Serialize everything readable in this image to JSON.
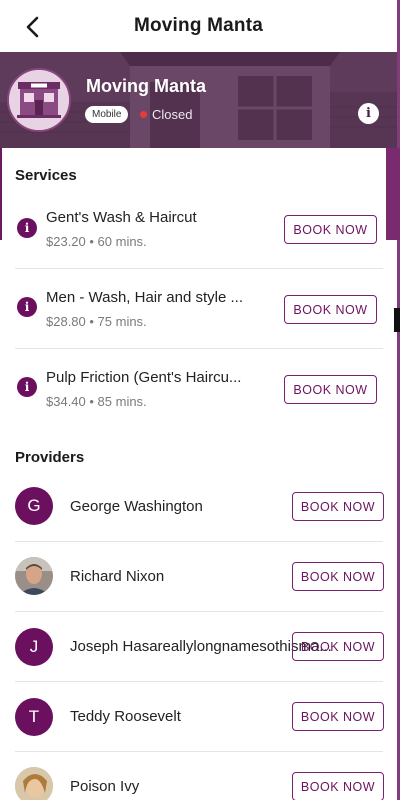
{
  "header": {
    "title": "Moving Manta"
  },
  "shop": {
    "name": "Moving Manta",
    "badge": "Mobile",
    "status": "Closed"
  },
  "colors": {
    "primary": "#6b0f5f",
    "status_closed": "#e53b3b",
    "banner": "#5f3b5c"
  },
  "services": {
    "title": "Services",
    "items": [
      {
        "name": "Gent's Wash & Haircut",
        "meta": "$23.20 • 60 mins.",
        "button": "BOOK NOW"
      },
      {
        "name": "Men - Wash, Hair and style ...",
        "meta": "$28.80 • 75 mins.",
        "button": "BOOK NOW"
      },
      {
        "name": "Pulp Friction (Gent's Haircu...",
        "meta": "$34.40 • 85 mins.",
        "button": "BOOK NOW"
      }
    ]
  },
  "providers": {
    "title": "Providers",
    "items": [
      {
        "initial": "G",
        "name": "George Washington",
        "button": "BOOK NOW"
      },
      {
        "initial": "",
        "name": "Richard Nixon",
        "button": "BOOK NOW"
      },
      {
        "initial": "J",
        "name": "Joseph Hasareallylongnamesothisma...",
        "button": "BOOK NOW"
      },
      {
        "initial": "T",
        "name": "Teddy Roosevelt",
        "button": "BOOK NOW"
      },
      {
        "initial": "",
        "name": "Poison Ivy",
        "button": "BOOK NOW"
      }
    ]
  },
  "icons": {
    "back": "arrow-left-icon",
    "info": "info-icon",
    "storefront": "storefront-icon"
  }
}
